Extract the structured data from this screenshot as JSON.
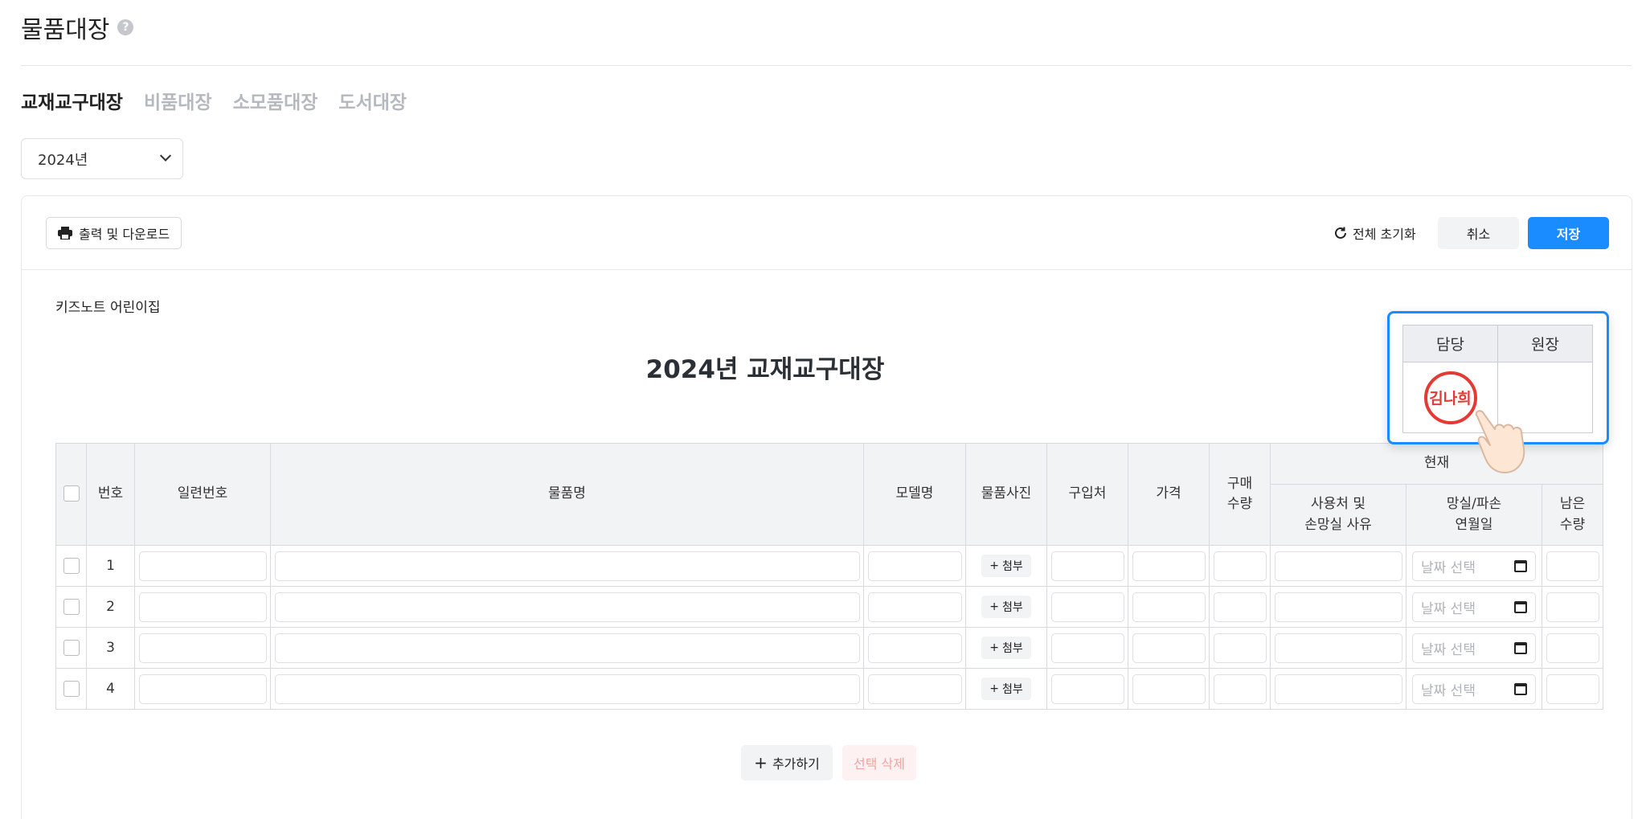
{
  "page": {
    "title": "물품대장",
    "help_icon": "question-circle-icon"
  },
  "tabs": [
    {
      "label": "교재교구대장",
      "active": true
    },
    {
      "label": "비품대장",
      "active": false
    },
    {
      "label": "소모품대장",
      "active": false
    },
    {
      "label": "도서대장",
      "active": false
    }
  ],
  "year_select": {
    "value": "2024년"
  },
  "toolbar": {
    "print_label": "출력 및 다운로드",
    "reset_label": "전체 초기화",
    "cancel_label": "취소",
    "save_label": "저장"
  },
  "document": {
    "org_name": "키즈노트 어린이집",
    "title": "2024년 교재교구대장"
  },
  "table": {
    "headers": {
      "number": "번호",
      "serial": "일련번호",
      "item_name": "물품명",
      "model": "모델명",
      "photo": "물품사진",
      "vendor": "구입처",
      "price": "가격",
      "purchase_qty_1": "구매",
      "purchase_qty_2": "수량",
      "current": "현재",
      "usage_1": "사용처 및",
      "usage_2": "손망실 사유",
      "lost_date_1": "망실/파손",
      "lost_date_2": "연월일",
      "remaining_1": "남은",
      "remaining_2": "수량"
    },
    "rows": [
      {
        "number": "1"
      },
      {
        "number": "2"
      },
      {
        "number": "3"
      },
      {
        "number": "4"
      }
    ],
    "attach_label": "첨부",
    "date_placeholder": "날짜 선택"
  },
  "actions": {
    "add_label": "추가하기",
    "delete_label": "선택 삭제"
  },
  "approval": {
    "col1": "담당",
    "col2": "원장",
    "stamp_text": "김나희"
  },
  "colors": {
    "accent": "#1a8cff",
    "stamp": "#e53935",
    "delete_text": "#f0a3a3"
  }
}
